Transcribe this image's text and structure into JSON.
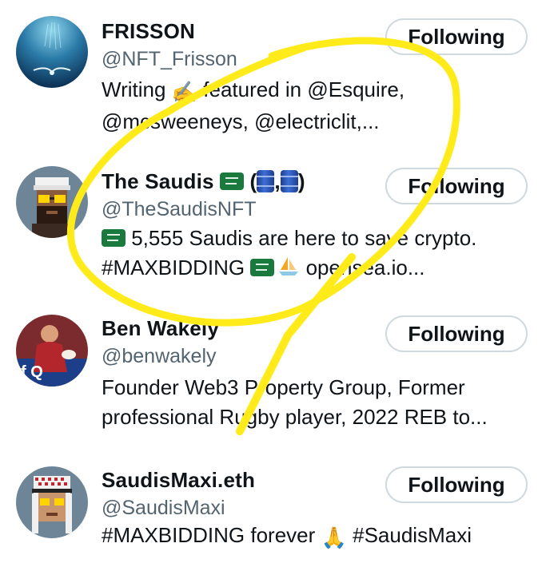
{
  "follow_list": [
    {
      "name": "FRISSON",
      "handle": "@NFT_Frisson",
      "bio_line1_a": "Writing ",
      "bio_line1_emoji": "✍️",
      "bio_line1_b": " featured in @Esquire,",
      "bio_line2": "@mcsweeneys, @electriclit,...",
      "button": "Following",
      "avatar_icon": "underwater-diver-avatar"
    },
    {
      "name_a": "The Saudis ",
      "name_b": " (",
      "name_c": ",",
      "name_d": ")",
      "handle": "@TheSaudisNFT",
      "bio_line1": " 5,555 Saudis are here to save crypto.",
      "bio_line2_a": "#MAXBIDDING ",
      "bio_line2_b": " opensea.io...",
      "button": "Following",
      "avatar_icon": "pixel-saudi-avatar"
    },
    {
      "name": "Ben Wakely",
      "handle": "@benwakely",
      "bio_line1": "Founder Web3 Property Group, Former",
      "bio_line2": "professional Rugby player, 2022 REB to...",
      "button": "Following",
      "avatar_icon": "rugby-player-photo-avatar"
    },
    {
      "name": "SaudisMaxi.eth",
      "handle": "@SaudisMaxi",
      "bio_line1_a": "#MAXBIDDING forever ",
      "bio_line1_emoji": "🙏",
      "bio_line1_b": " #SaudisMaxi",
      "button": "Following",
      "avatar_icon": "pixel-saudi-keffiyeh-avatar"
    }
  ],
  "overlay": {
    "annotation": "yellow-hand-drawn-circle-and-arrow",
    "color": "#ffeb1a"
  }
}
